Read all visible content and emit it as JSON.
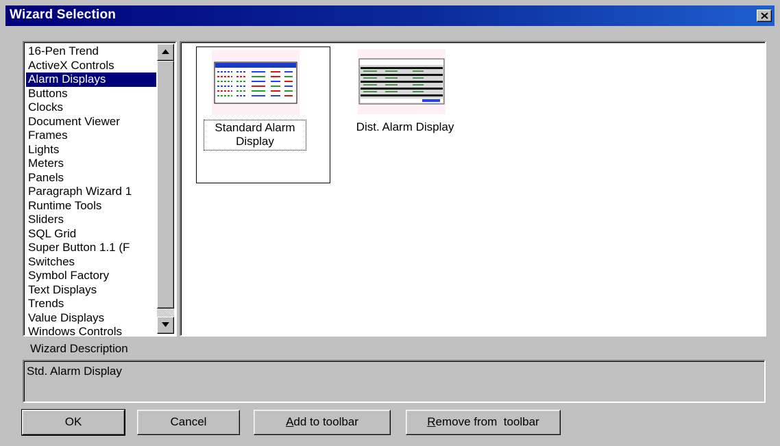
{
  "window": {
    "title": "Wizard Selection"
  },
  "categories": [
    "16-Pen Trend",
    "ActiveX Controls",
    "Alarm Displays",
    "Buttons",
    "Clocks",
    "Document Viewer",
    "Frames",
    "Lights",
    "Meters",
    "Panels",
    "Paragraph Wizard 1",
    "Runtime Tools",
    "Sliders",
    "SQL Grid",
    "Super Button 1.1 (F",
    "Switches",
    "Symbol Factory",
    "Text Displays",
    "Trends",
    "Value Displays",
    "Windows Controls"
  ],
  "selected_category": "Alarm Displays",
  "wizards": [
    {
      "label": "Standard Alarm Display",
      "selected": true
    },
    {
      "label": "Dist. Alarm Display",
      "selected": false
    }
  ],
  "description": {
    "label": "Wizard Description",
    "text": "Std. Alarm Display"
  },
  "buttons": {
    "ok": "OK",
    "cancel": "Cancel",
    "add_hotkey": "A",
    "add_rest": "dd to toolbar",
    "remove_hotkey": "R",
    "remove_rest": "emove from  toolbar"
  },
  "colors": {
    "title_bar": "#00007b",
    "selection": "#00007b",
    "face": "#c0c0c0"
  }
}
